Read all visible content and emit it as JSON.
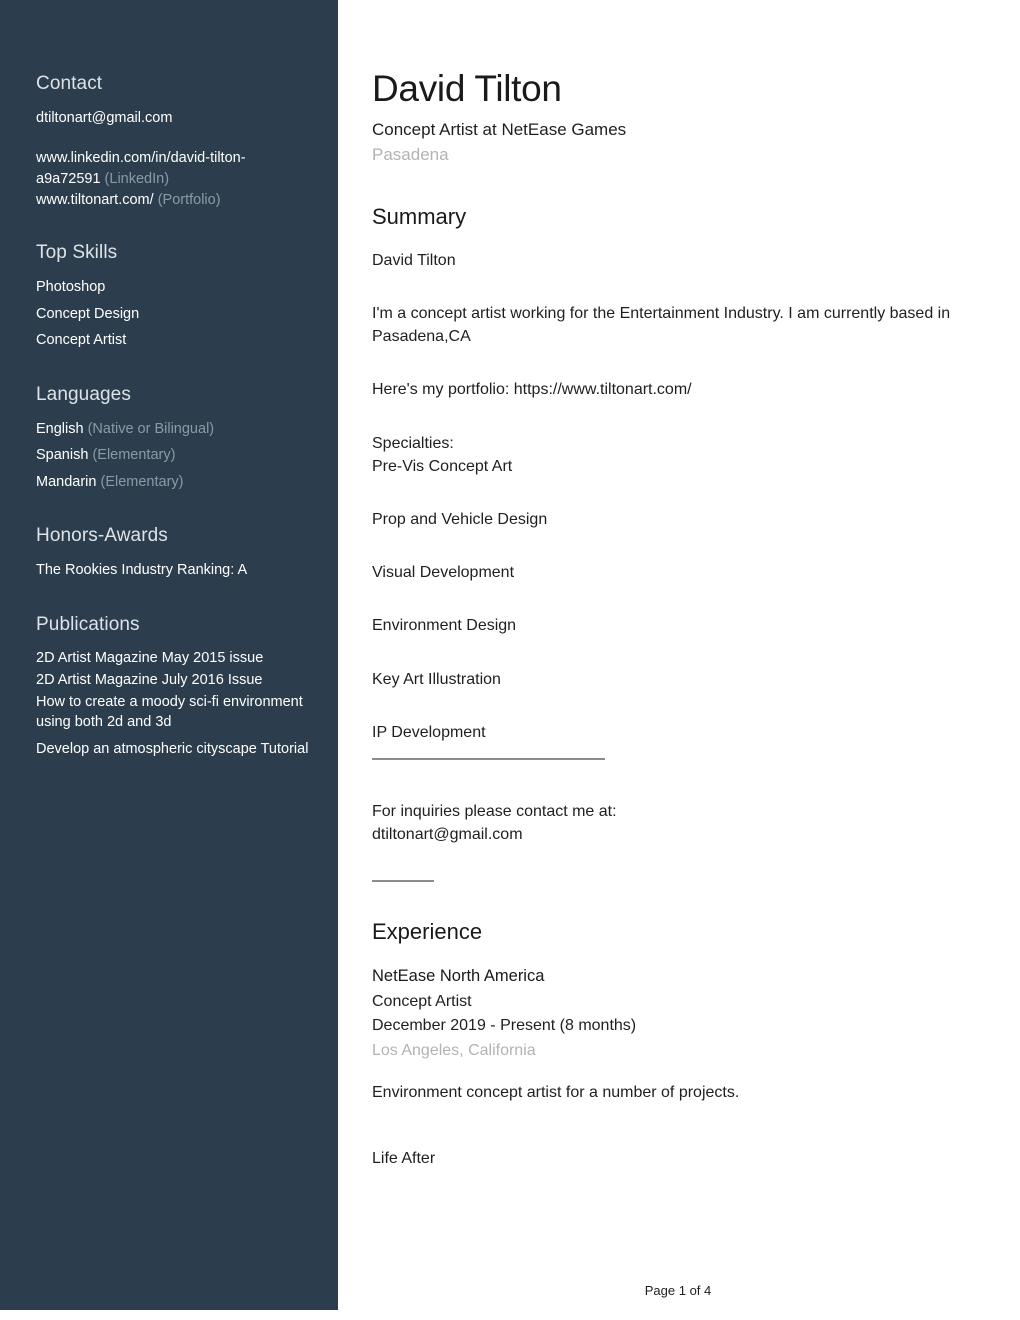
{
  "document": {
    "type": "linkedin-profile-pdf",
    "page_footer": "Page 1 of 4",
    "sidebar_bg_color": "#2c3e4d",
    "accent_muted_color": "#8a99a5",
    "location_gray_color": "#b3b3b3"
  },
  "sidebar": {
    "contact": {
      "heading": "Contact",
      "email": "dtiltonart@gmail.com",
      "links": [
        {
          "url": "www.linkedin.com/in/david-tilton-a9a72591",
          "label": "(LinkedIn)"
        },
        {
          "url": "www.tiltonart.com/",
          "label": "(Portfolio)"
        }
      ]
    },
    "top_skills": {
      "heading": "Top Skills",
      "items": [
        "Photoshop",
        "Concept Design",
        "Concept Artist"
      ]
    },
    "languages": {
      "heading": "Languages",
      "items": [
        {
          "name": "English",
          "level": "(Native or Bilingual)"
        },
        {
          "name": "Spanish",
          "level": "(Elementary)"
        },
        {
          "name": "Mandarin",
          "level": "(Elementary)"
        }
      ]
    },
    "honors_awards": {
      "heading": "Honors-Awards",
      "items": [
        "The Rookies Industry Ranking: A"
      ]
    },
    "publications": {
      "heading": "Publications",
      "items": [
        "2D Artist Magazine May 2015 issue",
        "2D Artist Magazine July 2016 Issue",
        "How to create a moody sci-fi environment using both 2d and 3d",
        "Develop an atmospheric cityscape Tutorial"
      ]
    }
  },
  "main": {
    "name": "David Tilton",
    "headline": "Concept Artist at NetEase Games",
    "location": "Pasadena",
    "summary": {
      "heading": "Summary",
      "signature": "David Tilton",
      "intro": "I'm a concept artist working for the Entertainment Industry. I am currently based in Pasadena,CA",
      "portfolio_line": "Here's my portfolio: https://www.tiltonart.com/",
      "specialties_label": "Specialties:",
      "specialties": [
        "Pre-Vis Concept Art",
        "Prop and Vehicle Design",
        "Visual Development",
        "Environment Design",
        "Key Art Illustration",
        "IP Development"
      ],
      "inquiries_line": "For inquiries please contact me at:",
      "inquiries_email": "dtiltonart@gmail.com"
    },
    "experience": {
      "heading": "Experience",
      "entries": [
        {
          "company": "NetEase North America",
          "role": "Concept Artist",
          "dates": "December 2019 - Present (8 months)",
          "place": "Los Angeles, California",
          "description": "Environment concept artist for a number of projects."
        },
        {
          "company": "Life After"
        }
      ]
    }
  }
}
